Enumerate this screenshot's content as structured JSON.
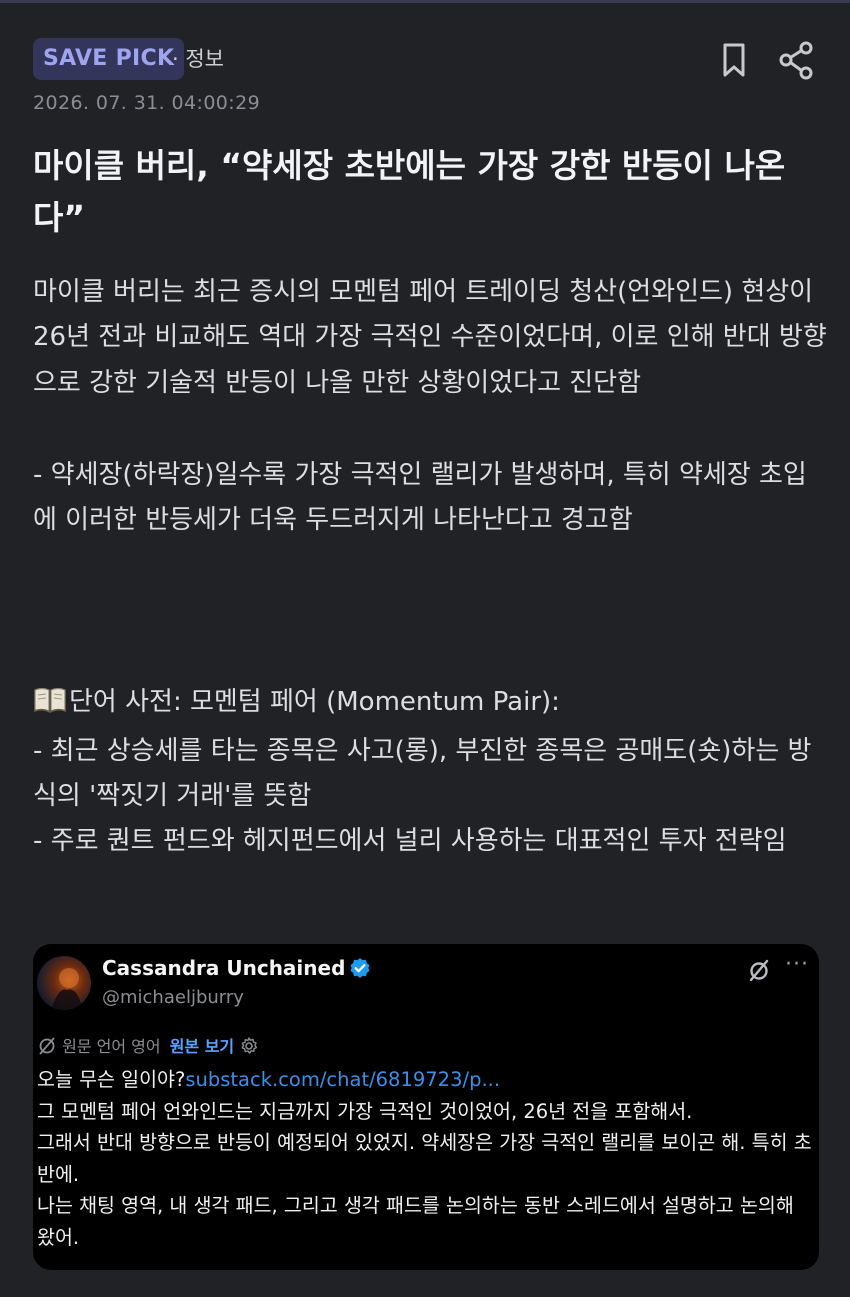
{
  "header": {
    "badge": "SAVE PICK",
    "category": "· 정보"
  },
  "post": {
    "date": "2026. 07. 31. 04:00:29",
    "title": "마이클 버리, “약세장 초반에는 가장 강한 반등이 나온다”",
    "paragraphs": [
      "마이클 버리는 최근 증시의 모멘텀 페어 트레이딩 청산(언와인드) 현상이 26년 전과 비교해도 역대 가장 극적인 수준이었다며, 이로 인해 반대 방향으로 강한 기술적 반등이 나올 만한 상황이었다고 진단함",
      "- 약세장(하락장)일수록 가장 극적인 랠리가 발생하며, 특히 약세장 초입에 이러한 반등세가 더욱 두드러지게 나타난다고 경고함"
    ],
    "glossary_title": "단어 사전: 모멘텀 페어 (Momentum Pair):",
    "glossary_items": [
      "- 최근 상승세를 타는 종목은 사고(롱), 부진한 종목은 공매도(숏)하는 방식의 '짝짓기 거래'를 뜻함",
      "- 주로 퀀트 펀드와 헤지펀드에서 널리 사용하는 대표적인 투자 전략임"
    ]
  },
  "tweet": {
    "name": "Cassandra Unchained",
    "handle": "@michaeljburry",
    "translate_label": "원문 언어 영어",
    "view_original": "원본 보기",
    "line1_text": "오늘 무슨 일이야?",
    "line1_link": "substack.com/chat/6819723/p...",
    "lines": [
      "그 모멘텀 페어 언와인드는 지금까지 가장 극적인 것이었어, 26년 전을 포함해서.",
      "그래서 반대 방향으로 반등이 예정되어 있었지. 약세장은 가장 극적인 랠리를 보이곤 해. 특히 초반에.",
      "나는 채팅 영역, 내 생각 패드, 그리고 생각 패드를 논의하는 동반 스레드에서 설명하고 논의해 왔어."
    ],
    "more": "···"
  },
  "colors": {
    "background": "#212226",
    "badge_bg": "#33355a",
    "badge_text": "#9ea4f0",
    "link": "#3b8fe8",
    "verified": "#1d9bf0"
  },
  "icons": [
    "bookmark-icon",
    "share-icon",
    "book-icon",
    "verified-icon",
    "hide-icon",
    "translate-icon",
    "settings-icon"
  ]
}
